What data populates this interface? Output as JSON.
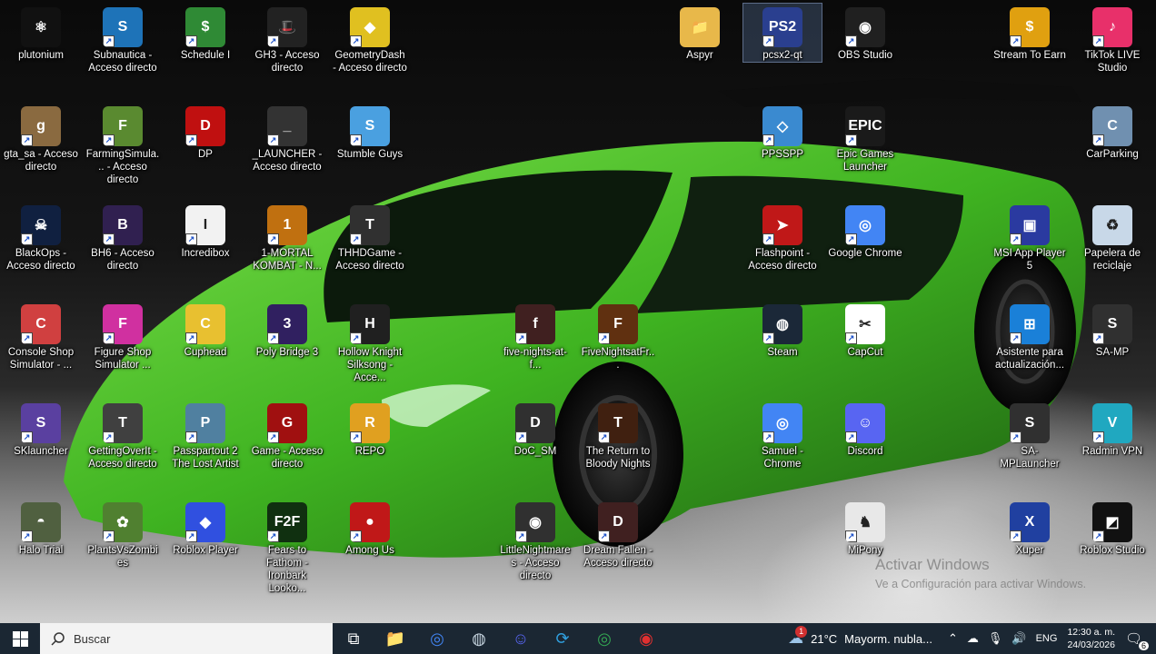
{
  "desktop": {
    "icons": [
      {
        "label": "plutonium",
        "icon": "atom-icon",
        "color": "#111111"
      },
      {
        "label": "Subnautica - Acceso directo",
        "icon": "subnautica-icon",
        "color": "#1e73b8"
      },
      {
        "label": "Schedule I",
        "icon": "dollar-icon",
        "color": "#2f8a35"
      },
      {
        "label": "GH3 - Acceso directo",
        "icon": "top-hat-icon",
        "color": "#222222"
      },
      {
        "label": "GeometryDash - Acceso directo",
        "icon": "geometry-dash-icon",
        "color": "#e0c020"
      },
      {
        "label": "Aspyr",
        "icon": "folder-icon",
        "color": "#e8b84a"
      },
      {
        "label": "pcsx2-qt",
        "icon": "pcsx2-icon",
        "color": "#2a3f8f"
      },
      {
        "label": "OBS Studio",
        "icon": "obs-icon",
        "color": "#202020"
      },
      {
        "label": "Stream To Earn",
        "icon": "coin-icon",
        "color": "#e0a010"
      },
      {
        "label": "TikTok LIVE Studio",
        "icon": "tiktok-icon",
        "color": "#e8306a"
      },
      {
        "label": "gta_sa - Acceso directo",
        "icon": "gta-icon",
        "color": "#8a6a40"
      },
      {
        "label": "FarmingSimula... - Acceso directo",
        "icon": "farming-icon",
        "color": "#5a8a30"
      },
      {
        "label": "DP",
        "icon": "dp-icon",
        "color": "#c01010"
      },
      {
        "label": "_LAUNCHER - Acceso directo",
        "icon": "tire-icon",
        "color": "#333333"
      },
      {
        "label": "Stumble Guys",
        "icon": "stumble-icon",
        "color": "#4aa0e0"
      },
      {
        "label": "PPSSPP",
        "icon": "ppsspp-icon",
        "color": "#3a8ad0"
      },
      {
        "label": "Epic Games Launcher",
        "icon": "epic-icon",
        "color": "#1a1a1a"
      },
      {
        "label": "CarParking",
        "icon": "carparking-icon",
        "color": "#7090b0"
      },
      {
        "label": "BlackOps - Acceso directo",
        "icon": "skull-icon",
        "color": "#102040"
      },
      {
        "label": "BH6 - Acceso directo",
        "icon": "bh6-icon",
        "color": "#302050"
      },
      {
        "label": "Incredibox",
        "icon": "incredibox-icon",
        "color": "#f2f2f2"
      },
      {
        "label": "1-MORTAL KOMBAT - N...",
        "icon": "dragon-icon",
        "color": "#c07010"
      },
      {
        "label": "THHDGame - Acceso directo",
        "icon": "skater-icon",
        "color": "#303030"
      },
      {
        "label": "Flashpoint - Acceso directo",
        "icon": "flashpoint-icon",
        "color": "#c01818"
      },
      {
        "label": "Google Chrome",
        "icon": "chrome-icon",
        "color": "#4285f4"
      },
      {
        "label": "MSI App Player 5",
        "icon": "msi-icon",
        "color": "#2a3aa0"
      },
      {
        "label": "Papelera de reciclaje",
        "icon": "recycle-bin-icon",
        "color": "#c8d8e8"
      },
      {
        "label": "Console Shop Simulator - ...",
        "icon": "console-shop-icon",
        "color": "#d04040"
      },
      {
        "label": "Figure Shop Simulator ...",
        "icon": "figure-shop-icon",
        "color": "#d030a0"
      },
      {
        "label": "Cuphead",
        "icon": "cuphead-icon",
        "color": "#e8c030"
      },
      {
        "label": "Poly Bridge 3",
        "icon": "poly-bridge-icon",
        "color": "#302060"
      },
      {
        "label": "Hollow Knight Silksong - Acce...",
        "icon": "hollow-knight-icon",
        "color": "#202020"
      },
      {
        "label": "five-nights-at-f...",
        "icon": "fnaf-icon",
        "color": "#402020"
      },
      {
        "label": "FiveNightsatFr...",
        "icon": "freddy-icon",
        "color": "#603010"
      },
      {
        "label": "Steam",
        "icon": "steam-icon",
        "color": "#1b2838"
      },
      {
        "label": "CapCut",
        "icon": "capcut-icon",
        "color": "#ffffff"
      },
      {
        "label": "Asistente para actualización...",
        "icon": "windows-icon",
        "color": "#1a80d8"
      },
      {
        "label": "SA-MP",
        "icon": "samp-icon",
        "color": "#303030"
      },
      {
        "label": "SKlauncher",
        "icon": "sklauncher-icon",
        "color": "#5a40a0"
      },
      {
        "label": "GettingOverIt - Acceso directo",
        "icon": "hammer-icon",
        "color": "#404040"
      },
      {
        "label": "Passpartout 2 The Lost Artist",
        "icon": "passpartout-icon",
        "color": "#5080a0"
      },
      {
        "label": "Game - Acceso directo",
        "icon": "spiderman-icon",
        "color": "#a01010"
      },
      {
        "label": "REPO",
        "icon": "repo-icon",
        "color": "#e0a020"
      },
      {
        "label": "DoC_SM",
        "icon": "doc-sm-icon",
        "color": "#303030"
      },
      {
        "label": "The Return to Bloody Nights",
        "icon": "bloody-nights-icon",
        "color": "#402010"
      },
      {
        "label": "Samuel - Chrome",
        "icon": "chrome-profile-icon",
        "color": "#4285f4"
      },
      {
        "label": "Discord",
        "icon": "discord-icon",
        "color": "#5865f2"
      },
      {
        "label": "SA-MPLauncher",
        "icon": "samp-launcher-icon",
        "color": "#303030"
      },
      {
        "label": "Radmin VPN",
        "icon": "radmin-icon",
        "color": "#20a8c0"
      },
      {
        "label": "Halo Trial",
        "icon": "halo-icon",
        "color": "#506040"
      },
      {
        "label": "PlantsVsZombies",
        "icon": "pvz-icon",
        "color": "#508030"
      },
      {
        "label": "Roblox Player",
        "icon": "roblox-icon",
        "color": "#3050e0"
      },
      {
        "label": "Fears to Fathom - Ironbark Looko...",
        "icon": "f2f-icon",
        "color": "#103010"
      },
      {
        "label": "Among Us",
        "icon": "among-us-icon",
        "color": "#c01818"
      },
      {
        "label": "LittleNightmares - Acceso directo",
        "icon": "eye-icon",
        "color": "#303030"
      },
      {
        "label": "Dream Fallen - Acceso directo",
        "icon": "dream-fallen-icon",
        "color": "#402020"
      },
      {
        "label": "MiPony",
        "icon": "mipony-icon",
        "color": "#e8e8e8"
      },
      {
        "label": "Xuper",
        "icon": "xuper-icon",
        "color": "#2040a0"
      },
      {
        "label": "Roblox Studio",
        "icon": "roblox-studio-icon",
        "color": "#111111"
      }
    ],
    "watermark": {
      "title": "Activar Windows",
      "subtitle": "Ve a Configuración para activar Windows."
    }
  },
  "taskbar": {
    "search_placeholder": "Buscar",
    "apps": [
      {
        "name": "task-view-icon",
        "color": "#ffffff"
      },
      {
        "name": "file-explorer-icon",
        "color": "#f0c040"
      },
      {
        "name": "chrome-icon",
        "color": "#4285f4"
      },
      {
        "name": "steam-icon",
        "color": "#c7d5e0"
      },
      {
        "name": "discord-icon",
        "color": "#5865f2"
      },
      {
        "name": "sync-icon",
        "color": "#30a0e0"
      },
      {
        "name": "chrome-profile-icon",
        "color": "#34a853"
      },
      {
        "name": "record-icon",
        "color": "#e03030"
      }
    ],
    "weather": {
      "temp": "21°C",
      "desc": "Mayorm. nubla...",
      "badge": "1"
    },
    "lang": "ENG",
    "time": "12:30 a. m.",
    "date": "24/03/2026",
    "notif_count": "6"
  }
}
